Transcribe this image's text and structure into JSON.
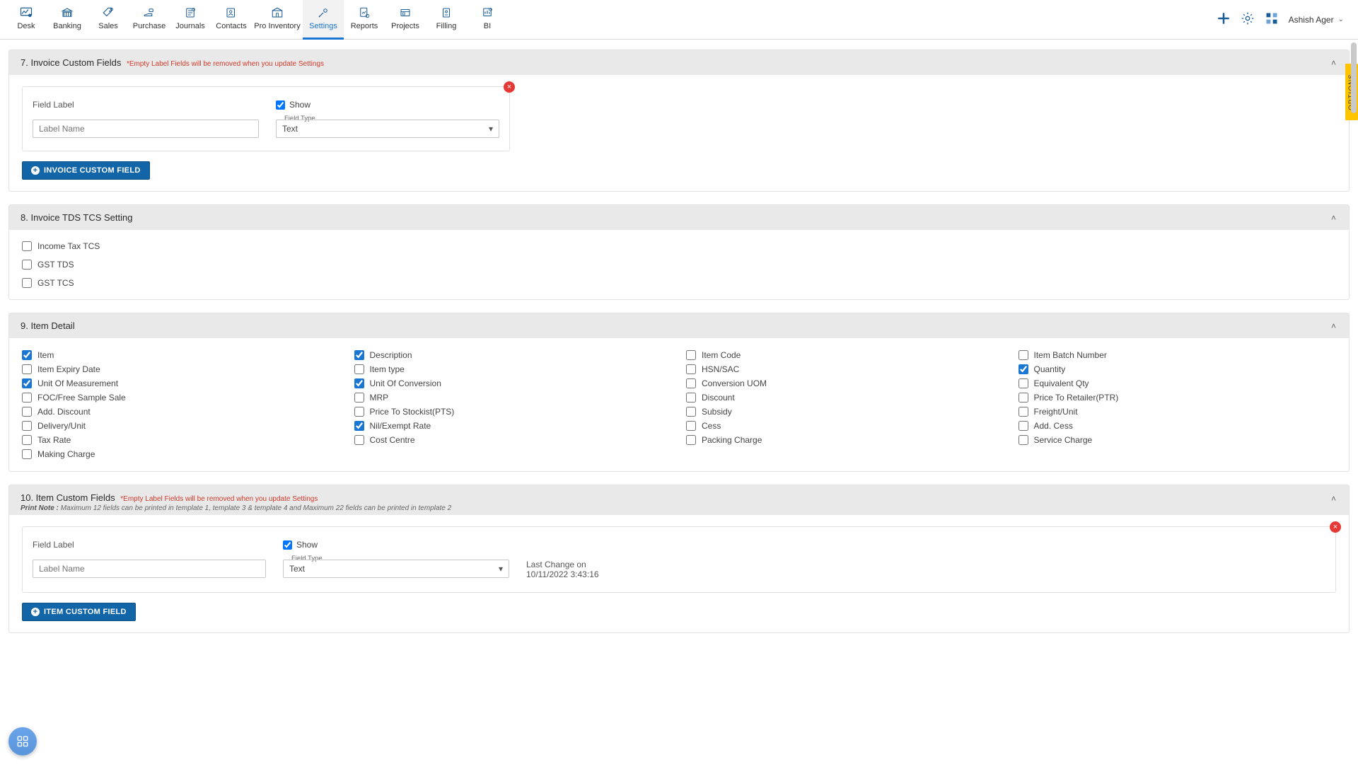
{
  "nav": {
    "items": [
      {
        "label": "Desk"
      },
      {
        "label": "Banking"
      },
      {
        "label": "Sales"
      },
      {
        "label": "Purchase"
      },
      {
        "label": "Journals"
      },
      {
        "label": "Contacts"
      },
      {
        "label": "Pro Inventory"
      },
      {
        "label": "Settings"
      },
      {
        "label": "Reports"
      },
      {
        "label": "Projects"
      },
      {
        "label": "Filling"
      },
      {
        "label": "BI"
      }
    ],
    "user": "Ashish Ager"
  },
  "options_tab": "OPTIONS",
  "panels": {
    "invoice_custom": {
      "title": "7. Invoice Custom Fields",
      "note": "*Empty Label Fields will be removed when you update Settings",
      "field_label": "Field Label",
      "show_label": "Show",
      "show_checked": true,
      "label_name_placeholder": "Label Name",
      "field_type_caption": "Field Type",
      "field_type_value": "Text",
      "add_btn": "INVOICE CUSTOM FIELD"
    },
    "tds": {
      "title": "8. Invoice TDS TCS Setting",
      "items": [
        {
          "label": "Income Tax TCS",
          "checked": false
        },
        {
          "label": "GST TDS",
          "checked": false
        },
        {
          "label": "GST TCS",
          "checked": false
        }
      ]
    },
    "item_detail": {
      "title": "9. Item Detail",
      "cols": [
        [
          {
            "label": "Item",
            "checked": true
          },
          {
            "label": "Item Expiry Date",
            "checked": false
          },
          {
            "label": " Unit Of Measurement",
            "checked": true
          },
          {
            "label": "FOC/Free Sample Sale",
            "checked": false
          },
          {
            "label": "Add. Discount",
            "checked": false
          },
          {
            "label": "Delivery/Unit",
            "checked": false
          },
          {
            "label": "Tax Rate",
            "checked": false
          },
          {
            "label": "Making Charge",
            "checked": false
          }
        ],
        [
          {
            "label": "Description",
            "checked": true
          },
          {
            "label": "Item type",
            "checked": false
          },
          {
            "label": "Unit Of Conversion",
            "checked": true
          },
          {
            "label": "MRP",
            "checked": false
          },
          {
            "label": "Price To Stockist(PTS)",
            "checked": false
          },
          {
            "label": "Nil/Exempt Rate",
            "checked": true
          },
          {
            "label": "Cost Centre",
            "checked": false
          }
        ],
        [
          {
            "label": "Item Code",
            "checked": false
          },
          {
            "label": "HSN/SAC",
            "checked": false
          },
          {
            "label": "Conversion UOM",
            "checked": false
          },
          {
            "label": "Discount",
            "checked": false
          },
          {
            "label": "Subsidy",
            "checked": false
          },
          {
            "label": "Cess",
            "checked": false
          },
          {
            "label": "Packing Charge",
            "checked": false
          }
        ],
        [
          {
            "label": "Item Batch Number",
            "checked": false
          },
          {
            "label": "Quantity",
            "checked": true
          },
          {
            "label": "Equivalent Qty",
            "checked": false
          },
          {
            "label": "Price To Retailer(PTR)",
            "checked": false
          },
          {
            "label": "Freight/Unit",
            "checked": false
          },
          {
            "label": "Add. Cess",
            "checked": false
          },
          {
            "label": "Service Charge",
            "checked": false
          }
        ]
      ]
    },
    "item_custom": {
      "title": "10. Item Custom Fields",
      "note": "*Empty Label Fields will be removed when you update Settings",
      "print_note_label": "Print Note :",
      "print_note": " Maximum 12 fields can be printed in template 1, template 3 & template 4 and Maximum 22 fields can be printed in template 2",
      "field_label": "Field Label",
      "show_label": "Show",
      "show_checked": true,
      "label_name_placeholder": "Label Name",
      "field_type_caption": "Field Type",
      "field_type_value": "Text",
      "last_change_label": "Last Change on",
      "last_change_value": "10/11/2022 3:43:16",
      "add_btn": "ITEM CUSTOM FIELD"
    }
  }
}
